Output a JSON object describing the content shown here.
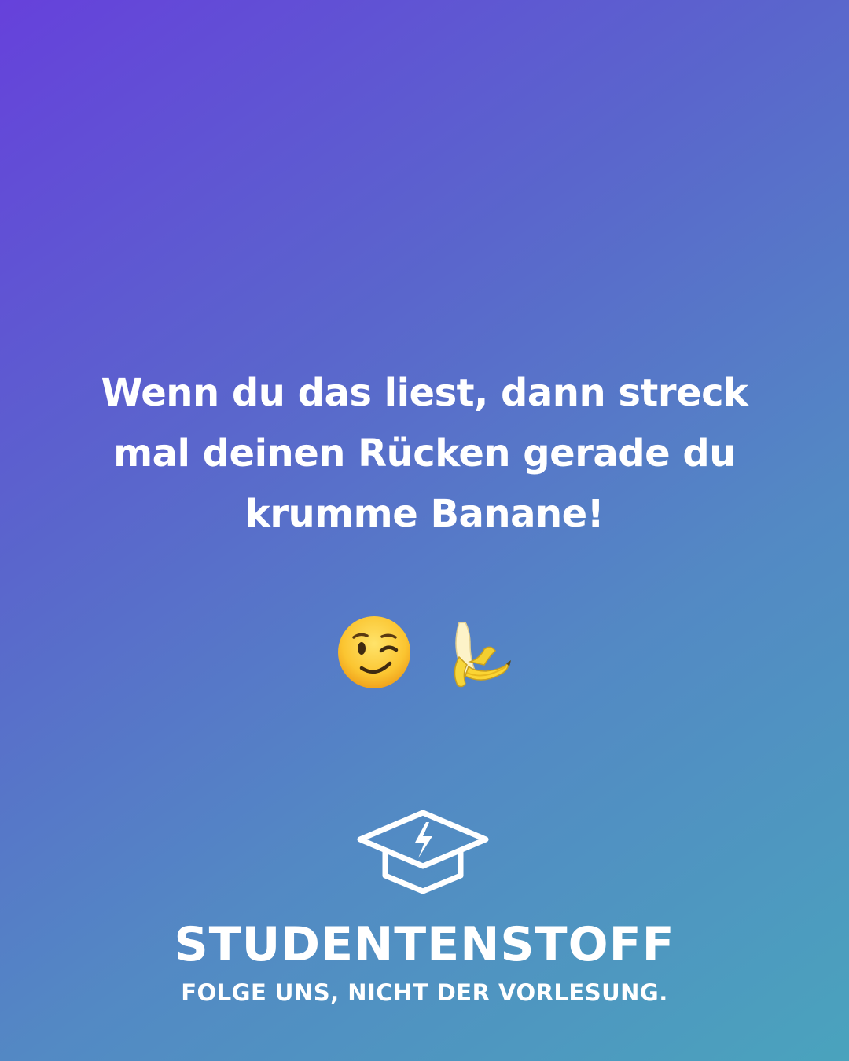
{
  "post": {
    "quote_lines": [
      "Wenn du das liest, dann streck",
      "mal deinen Rücken gerade du",
      "krumme Banane!"
    ]
  },
  "emojis": [
    {
      "name": "winking-face-emoji",
      "glyph": "😉"
    },
    {
      "name": "banana-emoji",
      "glyph": "🍌"
    }
  ],
  "brand": {
    "logo_icon": "graduation-cap-lightning-icon",
    "name": "STUDENTENSTOFF",
    "tagline": "FOLGE UNS, NICHT DER VORLESUNG."
  },
  "colors": {
    "gradient_start": "#6641db",
    "gradient_end": "#4aa3bd",
    "text": "#ffffff"
  }
}
